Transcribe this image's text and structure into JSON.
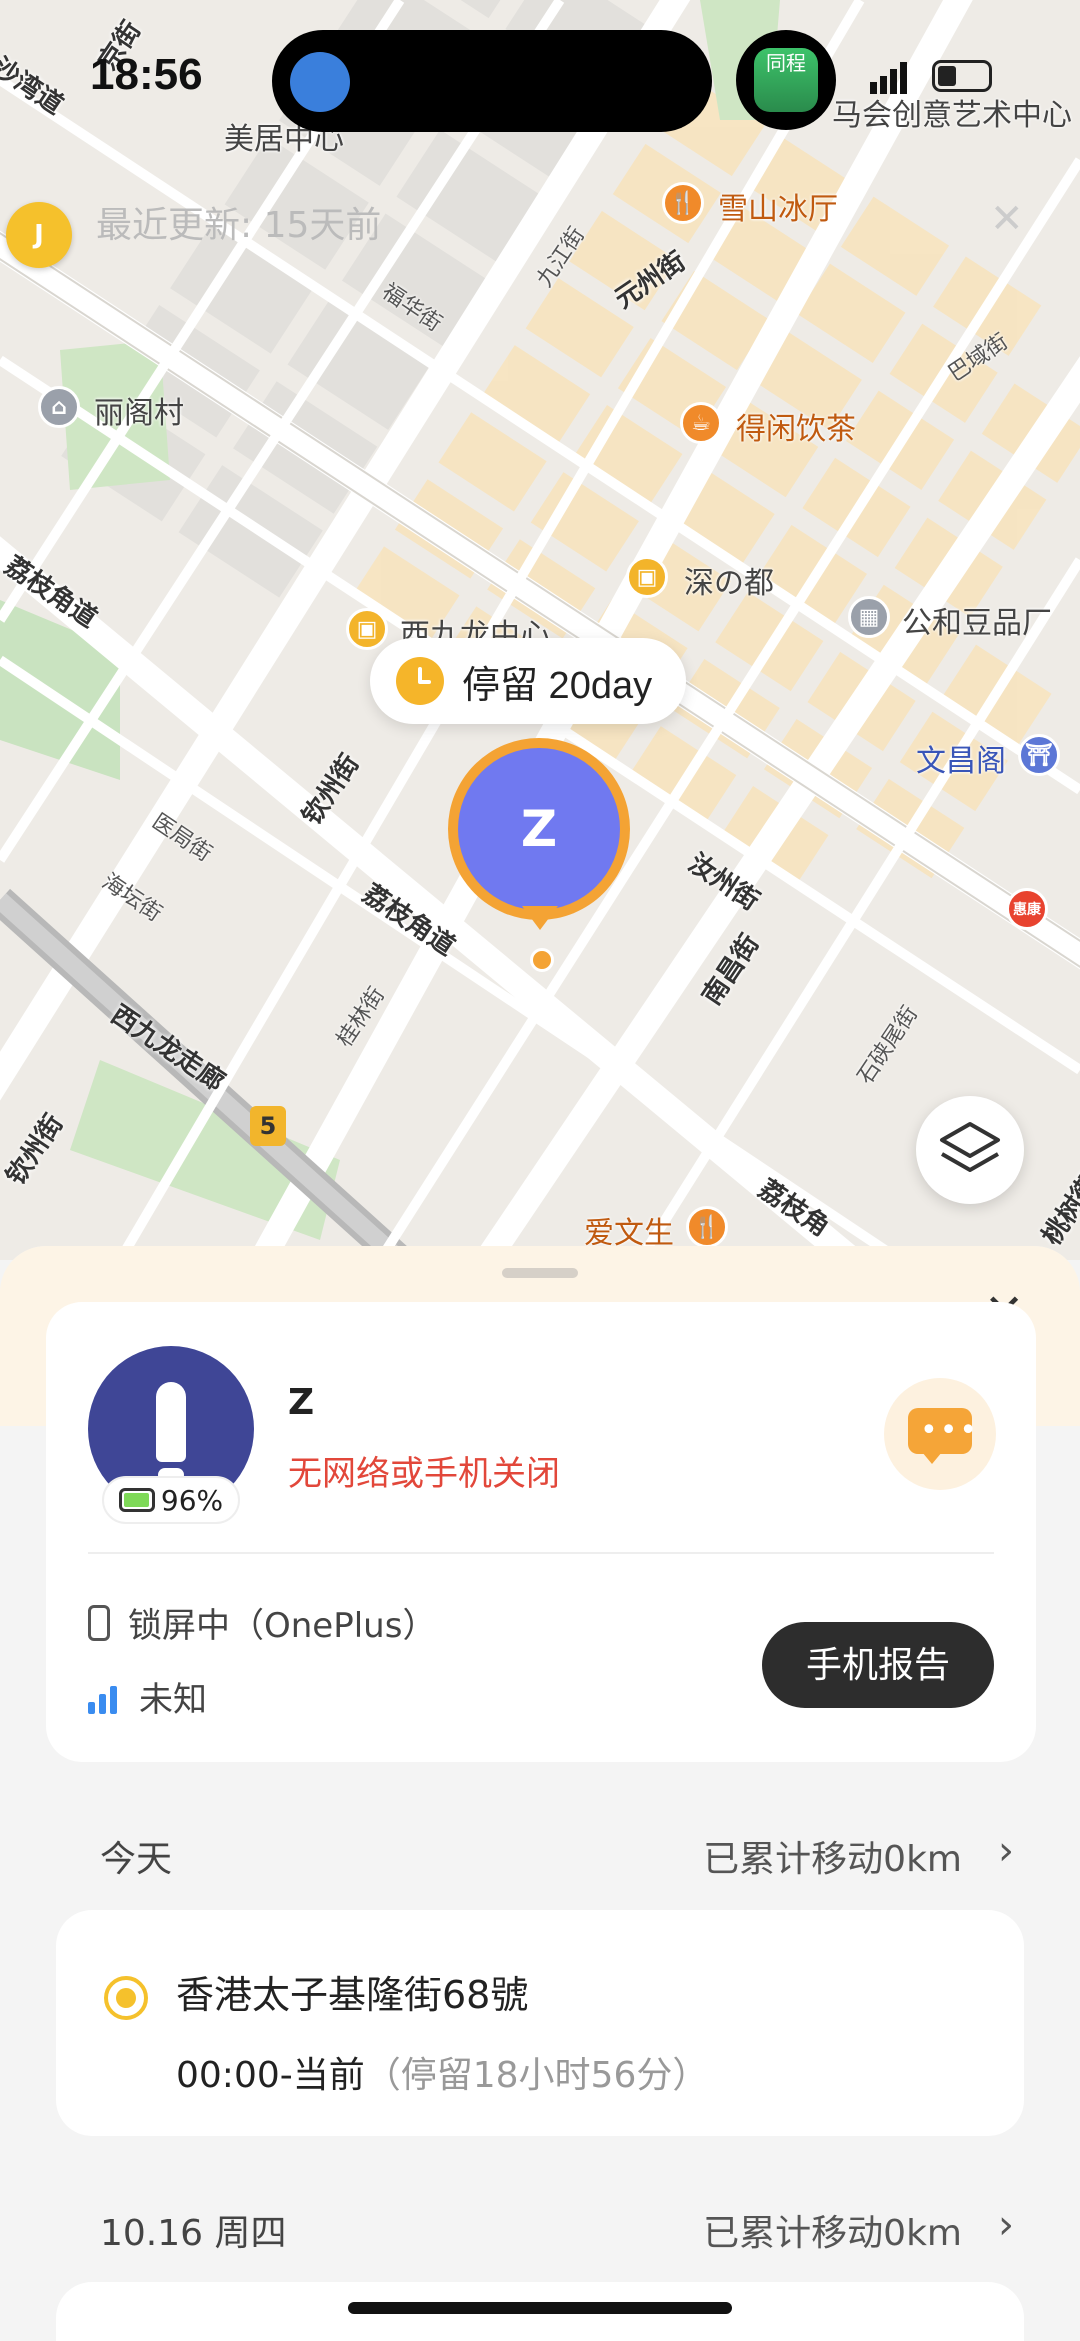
{
  "status_bar": {
    "time": "18:56",
    "island_app_label": "同程"
  },
  "map": {
    "recent_update": "最近更新: 15天前",
    "contact_initial": "J",
    "stay_label": "停留 20day",
    "marker_initial": "Z",
    "labels": {
      "l1": "美居中心",
      "l2": "雪山冰厅",
      "l3": "元州街",
      "l4": "福华街",
      "l5": "九江街",
      "l6": "丽阁村",
      "l7": "得闲饮茶",
      "l8": "巴域街",
      "l9": "荔枝角道",
      "l10": "深の都",
      "l11": "公和豆品厂",
      "l12": "西九龙中心",
      "l13": "文昌阁",
      "l14": "钦州街",
      "l15": "汝州街",
      "l16": "医局街",
      "l17": "海坛街",
      "l18": "荔枝角道",
      "l19": "南昌街",
      "l20": "桂林街",
      "l21": "西九龙走廊",
      "l22": "石硖尾街",
      "l23": "爱文生",
      "l24": "荔枝角",
      "l25": "钦州街",
      "l26": "马会创意艺术中心",
      "l27": "沙湾道",
      "l28": "京街",
      "l29": "桃树街",
      "l30": "惠康",
      "l31": "5"
    }
  },
  "sheet": {
    "user_name": "Z",
    "user_status": "无网络或手机关闭",
    "battery": "96%",
    "lock_status": "锁屏中（OnePlus）",
    "network": "未知",
    "report_button": "手机报告",
    "today": {
      "day": "今天",
      "moved": "已累计移动0km"
    },
    "visit": {
      "place": "香港太子基隆街68號",
      "time": "00:00-当前",
      "duration": "（停留18小时56分）"
    },
    "prev_day": {
      "day": "10.16 周四",
      "moved": "已累计移动0km"
    }
  }
}
